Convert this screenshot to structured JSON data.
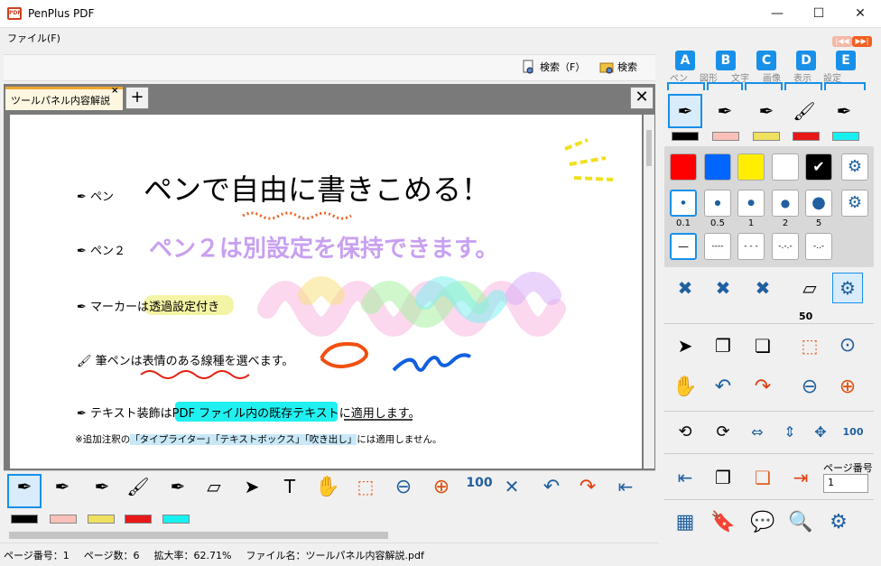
{
  "window": {
    "title": "PenPlus PDF",
    "minimize": "—",
    "maximize": "☐",
    "close": "✕",
    "app_icon_text": "PDF"
  },
  "menu": {
    "file": "ファイル(F)"
  },
  "search": {
    "btn1": "検索（F）",
    "btn2": "検索"
  },
  "tabs": {
    "active": "ツールパネル内容解説",
    "close": "×",
    "add": "+",
    "doc_close": "✕"
  },
  "document": {
    "row1": {
      "label": "ペン",
      "text": "ペンで自由に書きこめる！"
    },
    "row2": {
      "label": "ペン２",
      "text": "ペン２は別設定を保持できます。"
    },
    "row3": {
      "label_prefix": "マーカーは",
      "label_highlight": "透過設定付き"
    },
    "row4": {
      "label_prefix": "筆ペンは",
      "label_underline": "表情のある線種を選べ",
      "label_suffix": "ます。"
    },
    "row5": {
      "label_prefix": "テキスト装飾は",
      "label_highlight": "PDF ファイル内の既存テキスト",
      "label_mid": "に",
      "label_underline": "適用します。"
    },
    "note": {
      "prefix": "※追加注釈の",
      "q1": "「タイプライター」",
      "q2": "「テキストボックス」",
      "q3": "「吹き出し」",
      "suffix": "には適用しません。"
    }
  },
  "status": {
    "page_no": "ページ番号：1",
    "page_count": "ページ数：6",
    "zoom": "拡大率：62.71%",
    "filename": "ファイル名：ツールパネル内容解説.pdf"
  },
  "panel": {
    "letters": [
      "A",
      "B",
      "C",
      "D",
      "E"
    ],
    "tabs": [
      "ペン",
      "図形",
      "文字",
      "画像",
      "表示",
      "設定"
    ],
    "eraser_size": "50",
    "page_no_label": "ページ番号",
    "page_no_value": "1",
    "sizes": [
      "0.1",
      "0.5",
      "1",
      "2",
      "5"
    ],
    "line_styles": [
      "—",
      "----",
      "- - -",
      "-.-.-",
      "-..-"
    ]
  },
  "colors": {
    "swatches": [
      "#000000",
      "#f8c0b8",
      "#f0e060",
      "#e81818",
      "#18f0f0"
    ],
    "palette": [
      "#ff0000",
      "#0066ff",
      "#ffee00",
      "#ffffff",
      "#000000"
    ],
    "accent": "#1890e8",
    "tab_active": "#fdf6e0"
  }
}
